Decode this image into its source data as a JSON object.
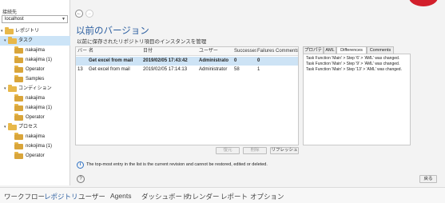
{
  "connection": {
    "label": "接続先",
    "value": "localhost"
  },
  "tree": [
    {
      "label": "レポジトリ",
      "level": 0,
      "expander": "▾"
    },
    {
      "label": "タスク",
      "level": 1,
      "expander": "▾",
      "selected": true
    },
    {
      "label": "nakajima",
      "level": 2
    },
    {
      "label": "nakajima (1)",
      "level": 2
    },
    {
      "label": "Operator",
      "level": 2
    },
    {
      "label": "Samples",
      "level": 2
    },
    {
      "label": "コンディション",
      "level": 1,
      "expander": "▾"
    },
    {
      "label": "nakajima",
      "level": 2
    },
    {
      "label": "nakajima (1)",
      "level": 2
    },
    {
      "label": "Operator",
      "level": 2
    },
    {
      "label": "プロセス",
      "level": 1,
      "expander": "▾"
    },
    {
      "label": "nakajima",
      "level": 2
    },
    {
      "label": "nokojima (1)",
      "level": 2
    },
    {
      "label": "Operator",
      "level": 2
    }
  ],
  "nav": {
    "back": "←",
    "forward": "→"
  },
  "page": {
    "title": "以前のバージョン",
    "subtitle": "以前に保存されたリポジトリ項目のインスタンスを管理"
  },
  "table": {
    "headers": [
      "バー",
      "名",
      "日付",
      "ユーザー",
      "Successes",
      "Failures",
      "Comments"
    ],
    "rows": [
      [
        "",
        "Get excel from mail",
        "2019/02/05 17:43:42",
        "Administrato",
        "0",
        "0",
        ""
      ],
      [
        "13",
        "Get excel from mail",
        "2019/02/05 17:14:13",
        "Administrator",
        "58",
        "1",
        ""
      ]
    ]
  },
  "buttons": {
    "restore": "復元",
    "delete": "削除",
    "refresh": "リフレッシュ",
    "back": "戻る"
  },
  "tabs": [
    "プロパティ",
    "AML",
    "Differences",
    "Comments"
  ],
  "active_tab": "Differences",
  "differences": [
    "Task Function 'Main' > Step '6' > 'AML' was changed.",
    "Task Function 'Main' > Step '9' > 'AML' was changed.",
    "Task Function 'Main' > Step '13' > 'AML' was changed."
  ],
  "info": "The top-most entry in the list is the current revision and cannot be restored, edited or deleted.",
  "help": "?",
  "bottom_nav": [
    "ワークフロー",
    "レポジトリ",
    "ユーザー",
    "Agents",
    "ダッシュボード",
    "カレンダー",
    "レポート",
    "オプション"
  ],
  "bottom_nav_active": "レポジトリ",
  "colors": {
    "accent": "#2a5d9f",
    "selection": "#cde3f5",
    "folder": "#e8b84a",
    "brand_red": "#d21f2b"
  }
}
